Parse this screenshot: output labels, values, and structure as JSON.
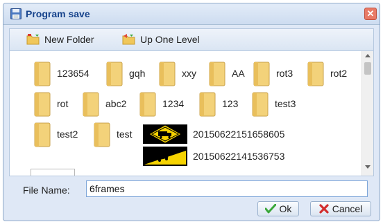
{
  "dialog": {
    "title": "Program save",
    "title_icon": "floppy-disk-icon",
    "close_icon": "close-icon"
  },
  "toolbar": {
    "new_folder_label": "New Folder",
    "new_folder_icon": "new-folder-icon",
    "up_level_label": "Up One Level",
    "up_level_icon": "up-folder-icon"
  },
  "files": {
    "folders": [
      "123654",
      "gqh",
      "xxy",
      "AA",
      "rot3",
      "rot2",
      "rot",
      "abc2",
      "1234",
      "123",
      "test3",
      "test2",
      "test"
    ],
    "programs": [
      "20150622151658605",
      "20150622141536753"
    ]
  },
  "filename": {
    "label": "File Name:",
    "value": "6frames"
  },
  "buttons": {
    "ok_label": "Ok",
    "cancel_label": "Cancel"
  },
  "colors": {
    "folder": "#f3d27a",
    "thumb_bg": "#000000",
    "thumb_sign": "#f6d300",
    "title_text": "#15428b",
    "ok_check": "#3aa73a",
    "cancel_x": "#d22d2d"
  }
}
